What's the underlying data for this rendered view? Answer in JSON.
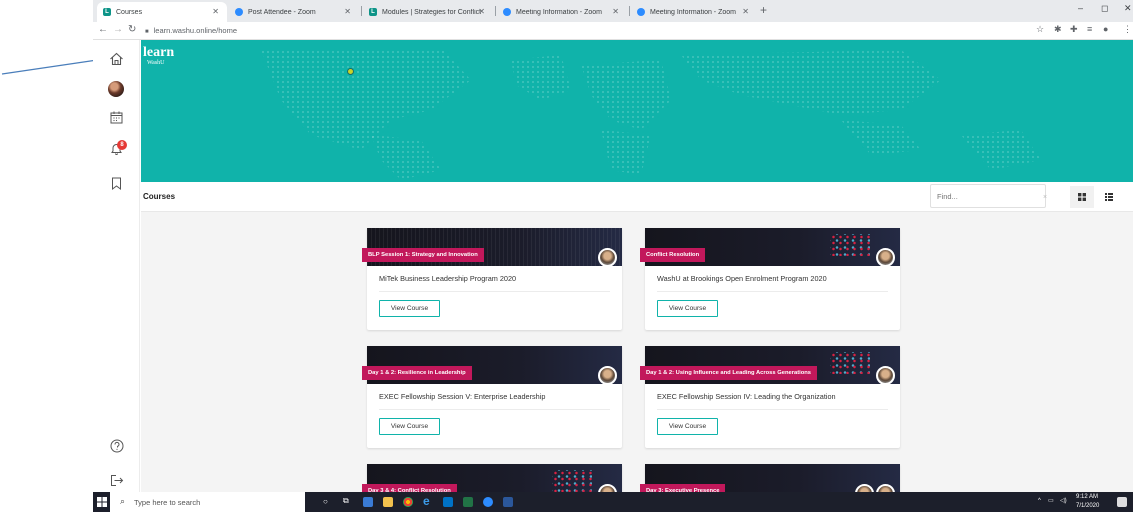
{
  "browser": {
    "tabs": [
      {
        "label": "Courses",
        "icon": "learn-favicon",
        "active": true
      },
      {
        "label": "Post Attendee - Zoom",
        "icon": "zoom-favicon",
        "active": false
      },
      {
        "label": "Modules | Strategies for Conflict",
        "icon": "learn-favicon",
        "active": false
      },
      {
        "label": "Meeting Information - Zoom",
        "icon": "zoom-favicon",
        "active": false
      },
      {
        "label": "Meeting Information - Zoom",
        "icon": "zoom-favicon",
        "active": false
      }
    ],
    "url": "learn.washu.online/home",
    "new_tab": "+",
    "window_controls": {
      "minimize": "–",
      "maximize": "◻",
      "close": "✕"
    }
  },
  "app": {
    "logo_primary": "learn",
    "logo_secondary": "WashU",
    "notification_count": "8"
  },
  "courses_header": {
    "title": "Courses",
    "find_placeholder": "Find...",
    "clear": "×"
  },
  "courses": [
    {
      "tag": "BLP Session 1: Strategy and Innovation",
      "title": "MiTek Business Leadership Program 2020",
      "button": "View Course"
    },
    {
      "tag": "Conflict Resolution",
      "title": "WashU at Brookings Open Enrolment Program 2020",
      "button": "View Course"
    },
    {
      "tag": "Day 1 & 2: Resilience in Leadership",
      "title": "EXEC Fellowship Session V: Enterprise Leadership",
      "button": "View Course"
    },
    {
      "tag": "Day 1 & 2: Using Influence and Leading Across Generations",
      "title": "EXEC Fellowship Session IV: Leading the Organization",
      "button": "View Course"
    },
    {
      "tag": "Day 3 & 4: Conflict Resolution"
    },
    {
      "tag": "Day 3: Executive Presence"
    }
  ],
  "taskbar": {
    "search_placeholder": "Type here to search",
    "time": "9:12 AM",
    "date": "7/1/2020"
  },
  "colors": {
    "brand_teal": "#10b3aa",
    "tag_magenta": "#c2185b",
    "badge_red": "#e53935"
  }
}
